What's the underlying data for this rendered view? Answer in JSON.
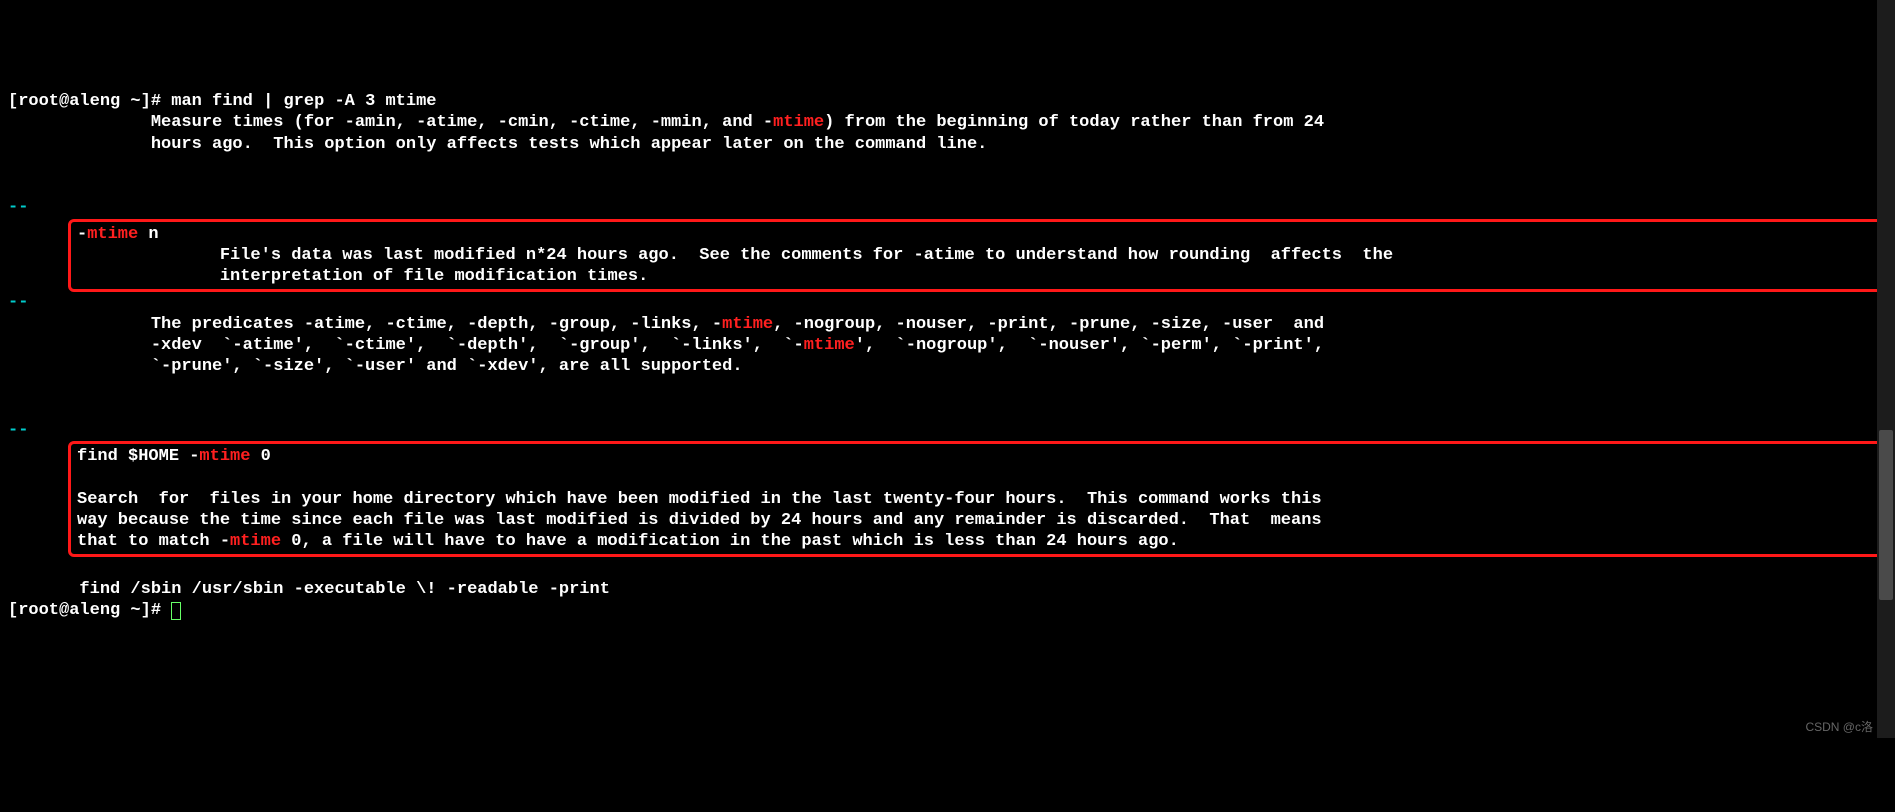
{
  "prompt": {
    "open": "[",
    "user_host": "root@aleng",
    "tilde": " ~",
    "close": "]# "
  },
  "command": "man find | grep -A 3 mtime",
  "para1": {
    "line1_a": "              Measure times (for -amin, -atime, -cmin, -ctime, -mmin, and -",
    "line1_b": ") from the beginning of today rather than from 24",
    "line2": "              hours ago.  This option only affects tests which appear later on the command line."
  },
  "sep": "--",
  "box1": {
    "head_a": "-",
    "head_b": " n",
    "body1": "              File's data was last modified n*24 hours ago.  See the comments for -atime to understand how rounding  affects  the",
    "body2": "              interpretation of file modification times."
  },
  "para2": {
    "l1a": "              The predicates -atime, -ctime, -depth, -group, -links, -",
    "l1b": ", -nogroup, -nouser, -print, -prune, -size, -user  and",
    "l2a": "              -xdev  `-atime',  `-ctime',  `-depth',  `-group',  `-links',  `-",
    "l2b": "',  `-nogroup',  `-nouser', `-perm', `-print',",
    "l3": "              `-prune', `-size', `-user' and `-xdev', are all supported."
  },
  "box2": {
    "head_a": "find $HOME -",
    "head_b": " 0",
    "body1": "Search  for  files in your home directory which have been modified in the last twenty-four hours.  This command works this",
    "body2": "way because the time since each file was last modified is divided by 24 hours and any remainder is discarded.  That  means",
    "body3a": "that to match -",
    "body3b": " 0, a file will have to have a modification in the past which is less than 24 hours ago."
  },
  "tail": {
    "line": "       find /sbin /usr/sbin -executable \\! -readable -print"
  },
  "hl_word": "mtime",
  "watermark": "CSDN @c洛"
}
